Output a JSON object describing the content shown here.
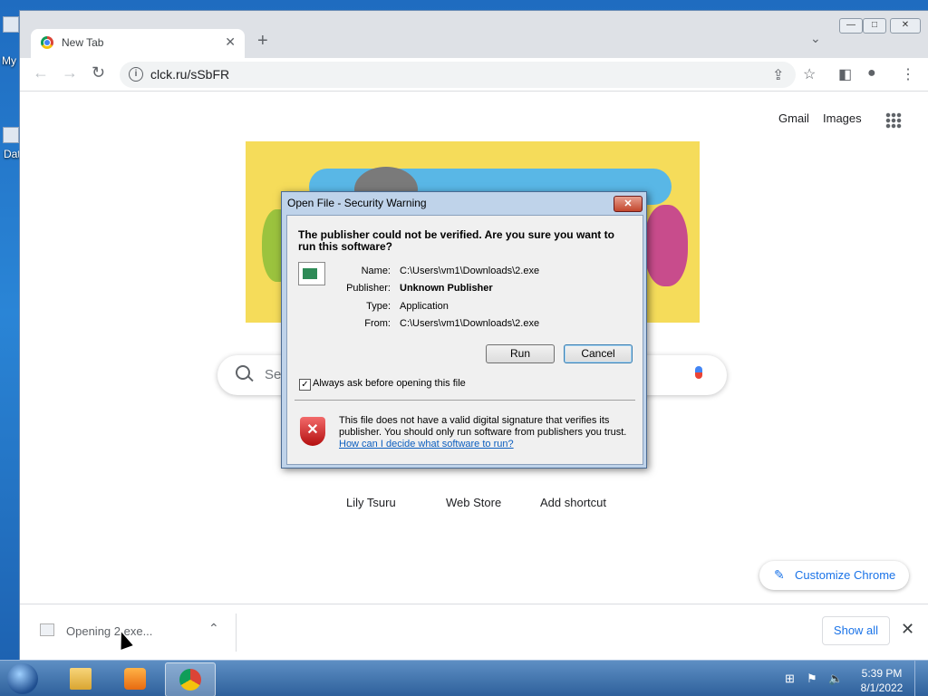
{
  "desktop": {
    "labels": [
      "My",
      "Dat"
    ]
  },
  "browser": {
    "tab": {
      "title": "New Tab",
      "close": "✕"
    },
    "newtab": "+",
    "tabs_dropdown": "⌄",
    "window_buttons": {
      "minimize": "—",
      "maximize": "□",
      "close": "✕"
    },
    "nav": {
      "back": "←",
      "forward": "→",
      "reload": "↻"
    },
    "omnibox": {
      "info": "i",
      "url": "clck.ru/sSbFR"
    },
    "toolbar_icons": {
      "share": "⇪",
      "star": "☆",
      "sidepanel": "◧",
      "profile": "●",
      "menu": "⋮"
    }
  },
  "newtab_page": {
    "links": {
      "gmail": "Gmail",
      "images": "Images"
    },
    "search_placeholder": "Se",
    "shortcuts": [
      "Lily Tsuru",
      "Web Store",
      "Add shortcut"
    ],
    "customize": {
      "pen": "✎",
      "label": "Customize Chrome"
    }
  },
  "download_bar": {
    "item_label": "Opening 2.exe...",
    "chevron": "⌃",
    "show_all": "Show all",
    "close": "✕"
  },
  "dialog": {
    "title": "Open File - Security Warning",
    "close": "✕",
    "question": "The publisher could not be verified.  Are you sure you want to run this software?",
    "fields": [
      {
        "key": "Name:",
        "value": "C:\\Users\\vm1\\Downloads\\2.exe",
        "bold": false
      },
      {
        "key": "Publisher:",
        "value": "Unknown Publisher",
        "bold": true
      },
      {
        "key": "Type:",
        "value": "Application",
        "bold": false
      },
      {
        "key": "From:",
        "value": "C:\\Users\\vm1\\Downloads\\2.exe",
        "bold": false
      }
    ],
    "run_label": "Run",
    "cancel_label": "Cancel",
    "always_ask": {
      "checked": true,
      "label": "Always ask before opening this file",
      "mark": "✓"
    },
    "shield_mark": "✕",
    "warning_text": "This file does not have a valid digital signature that verifies its publisher.  You should only run software from publishers you trust.",
    "help_link": "How can I decide what software to run?"
  },
  "taskbar": {
    "clock": {
      "time": "5:39 PM",
      "date": "8/1/2022"
    },
    "tray": {
      "network": "⊞",
      "flag": "⚑",
      "volume": "🔈"
    }
  }
}
